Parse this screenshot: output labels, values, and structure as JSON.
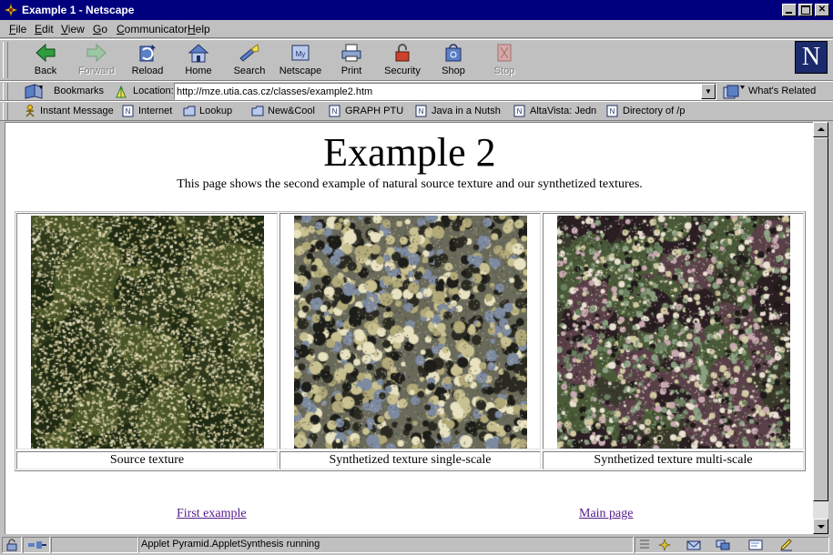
{
  "window": {
    "title": "Example 1 - Netscape",
    "icon": "netscape-star-icon"
  },
  "menu": [
    "File",
    "Edit",
    "View",
    "Go",
    "Communicator",
    "Help"
  ],
  "toolbar": [
    {
      "label": "Back",
      "icon": "back-arrow-icon",
      "enabled": true
    },
    {
      "label": "Forward",
      "icon": "forward-arrow-icon",
      "enabled": false
    },
    {
      "label": "Reload",
      "icon": "reload-icon",
      "enabled": true
    },
    {
      "label": "Home",
      "icon": "home-icon",
      "enabled": true
    },
    {
      "label": "Search",
      "icon": "search-flashlight-icon",
      "enabled": true
    },
    {
      "label": "Netscape",
      "icon": "my-netscape-icon",
      "enabled": true
    },
    {
      "label": "Print",
      "icon": "printer-icon",
      "enabled": true
    },
    {
      "label": "Security",
      "icon": "padlock-icon",
      "enabled": true
    },
    {
      "label": "Shop",
      "icon": "shop-bag-icon",
      "enabled": true
    },
    {
      "label": "Stop",
      "icon": "stop-icon",
      "enabled": false
    }
  ],
  "location": {
    "bookmarks_label": "Bookmarks",
    "location_label": "Location:",
    "url": "http://mze.utia.cas.cz/classes/example2.htm",
    "whats_related": "What's Related"
  },
  "personal_toolbar": [
    {
      "label": "Instant Message",
      "icon": "instant-message-icon"
    },
    {
      "label": "Internet",
      "icon": "page-n-icon"
    },
    {
      "label": "Lookup",
      "icon": "folder-icon"
    },
    {
      "label": "New&Cool",
      "icon": "folder-icon"
    },
    {
      "label": "GRAPH PTU",
      "icon": "page-n-icon"
    },
    {
      "label": "Java in a Nutsh",
      "icon": "page-n-icon"
    },
    {
      "label": "AltaVista: Jedn",
      "icon": "page-n-icon"
    },
    {
      "label": "Directory of /p",
      "icon": "page-n-icon"
    }
  ],
  "page": {
    "heading": "Example 2",
    "intro": "This page shows the second example of natural source texture and our synthetized textures.",
    "textures": [
      {
        "caption": "Source texture"
      },
      {
        "caption": "Synthetized texture single-scale"
      },
      {
        "caption": "Synthetized texture multi-scale"
      }
    ],
    "links": {
      "first": "First example",
      "main": "Main page"
    }
  },
  "status": {
    "text": "Applet Pyramid.AppletSynthesis running"
  },
  "colors": {
    "titlebar": "#00007f",
    "chrome": "#c0c0c0",
    "link_visited": "#551a8b"
  }
}
